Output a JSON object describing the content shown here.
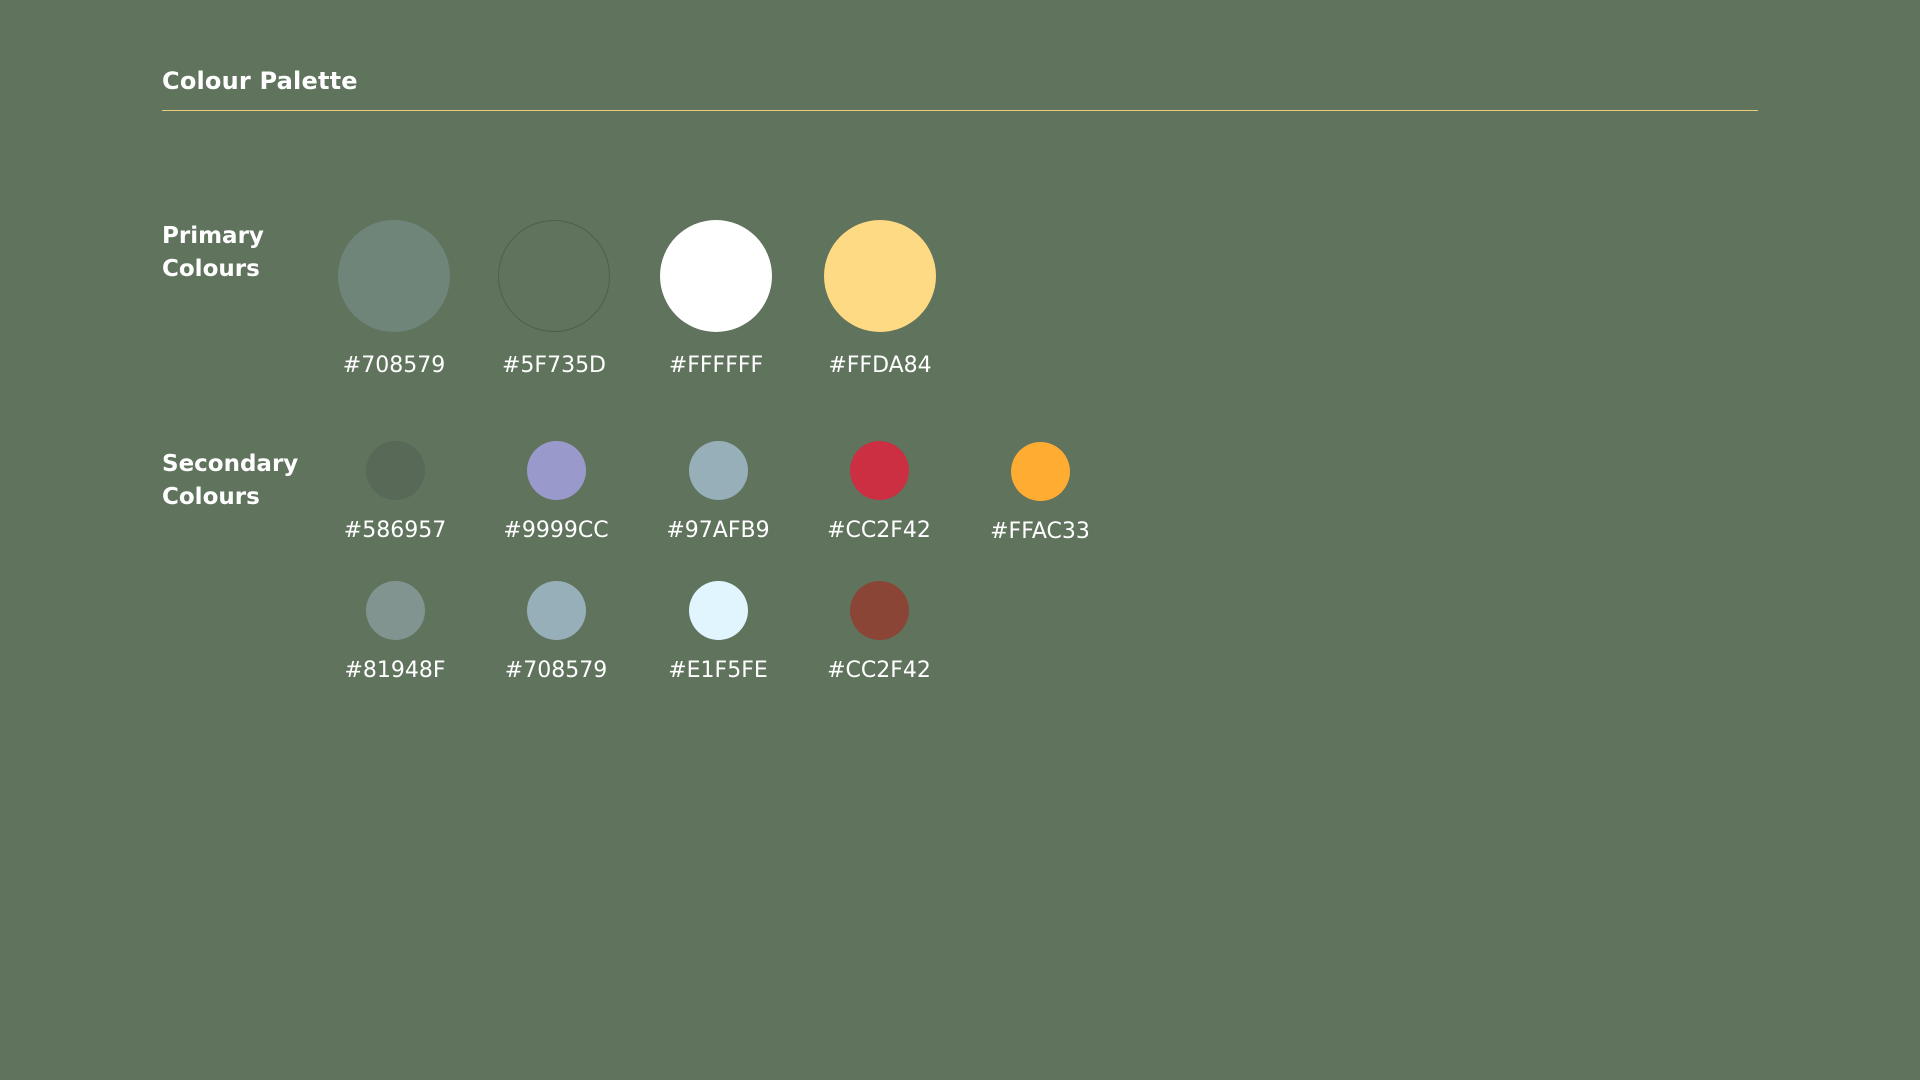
{
  "header": {
    "title": "Colour Palette"
  },
  "primary": {
    "label": "Primary\nColours",
    "swatches": [
      {
        "hex": "#708579",
        "label": "#708579"
      },
      {
        "hex": "#5F735D",
        "label": "#5F735D"
      },
      {
        "hex": "#FFFFFF",
        "label": "#FFFFFF"
      },
      {
        "hex": "#FFDA84",
        "label": "#FFDA84"
      }
    ]
  },
  "secondary": {
    "label": "Secondary\nColours",
    "swatches": [
      {
        "hex": "#586957",
        "label": "#586957"
      },
      {
        "hex": "#9999CC",
        "label": "#9999CC"
      },
      {
        "hex": "#97AFB9",
        "label": "#97AFB9"
      },
      {
        "hex": "#CC2F42",
        "label": "#CC2F42"
      },
      {
        "hex": "#FFAC33",
        "label": "#FFAC33"
      },
      {
        "hex": "#81948F",
        "label": "#81948F"
      },
      {
        "hex": "#97AFB9",
        "label": "#708579"
      },
      {
        "hex": "#E1F5FE",
        "label": "#E1F5FE"
      },
      {
        "hex": "#8B4536",
        "label": "#CC2F42"
      }
    ]
  }
}
